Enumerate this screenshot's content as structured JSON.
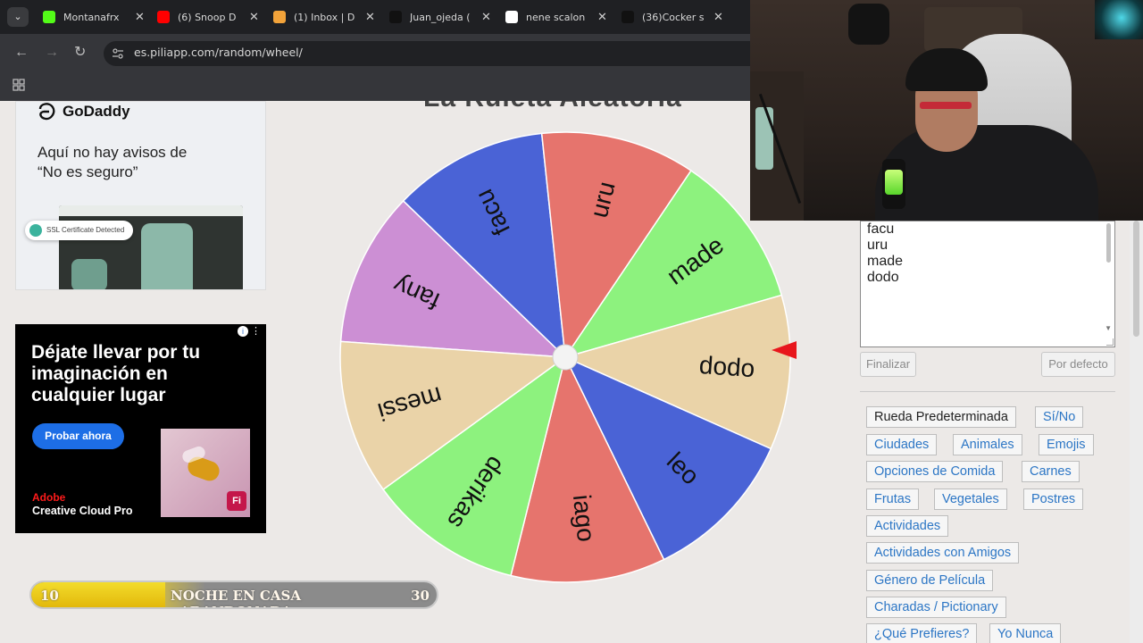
{
  "browser": {
    "tabs": [
      {
        "title": "Montanafrx",
        "icon": "kick-icon",
        "color": "#53fc18"
      },
      {
        "title": "(6) Snoop D",
        "icon": "youtube-icon",
        "color": "#ff0000"
      },
      {
        "title": "(1) Inbox | D",
        "icon": "mail-icon",
        "color": "#f2a33a"
      },
      {
        "title": "Juan_ojeda (",
        "icon": "tiktok-icon",
        "color": "#111111"
      },
      {
        "title": "nene scalon",
        "icon": "google-icon",
        "color": "#ffffff"
      },
      {
        "title": "(36)Cocker s",
        "icon": "tiktok-icon",
        "color": "#111111"
      }
    ],
    "url": "es.piliapp.com/random/wheel/"
  },
  "ads": {
    "ad1": {
      "brand": "GoDaddy",
      "headline_line1": "Aquí no hay avisos de",
      "headline_line2": "“No es seguro”",
      "badge": "SSL Certificate Detected"
    },
    "ad2": {
      "headline": "Déjate llevar por tu imaginación en cualquier lugar",
      "cta": "Probar ahora",
      "brand_line1": "Adobe",
      "brand_line2": "Creative Cloud Pro",
      "app_badge": "Fi"
    }
  },
  "wheel": {
    "title": "La Ruleta Aleatoria",
    "segments": [
      {
        "label": "fany",
        "color": "#cc8fd4"
      },
      {
        "label": "facu",
        "color": "#4a63d6"
      },
      {
        "label": "uru",
        "color": "#e6746d"
      },
      {
        "label": "made",
        "color": "#8df27e"
      },
      {
        "label": "dodo",
        "color": "#ead3a8"
      },
      {
        "label": "leo",
        "color": "#4a63d6"
      },
      {
        "label": "iago",
        "color": "#e6746d"
      },
      {
        "label": "derikas",
        "color": "#8df27e"
      },
      {
        "label": "messi",
        "color": "#ead3a8"
      }
    ],
    "pointer_color": "#e8161c"
  },
  "entries": {
    "visible_lines": [
      "facu",
      "uru",
      "made",
      "dodo"
    ]
  },
  "buttons": {
    "finalize": "Finalizar",
    "default": "Por defecto"
  },
  "presets": [
    "Rueda Predeterminada",
    "Sí/No",
    "Ciudades",
    "Animales",
    "Emojis",
    "Opciones de Comida",
    "Carnes",
    "Frutas",
    "Vegetales",
    "Postres",
    "Actividades",
    "Actividades con Amigos",
    "Género de Película",
    "Charadas / Pictionary",
    "¿Qué Prefieres?",
    "Yo Nunca"
  ],
  "overlay_bar": {
    "left_value": "10",
    "title": "NOCHE EN CASA ABANDONADA",
    "right_value": "30",
    "progress": 0.33
  }
}
